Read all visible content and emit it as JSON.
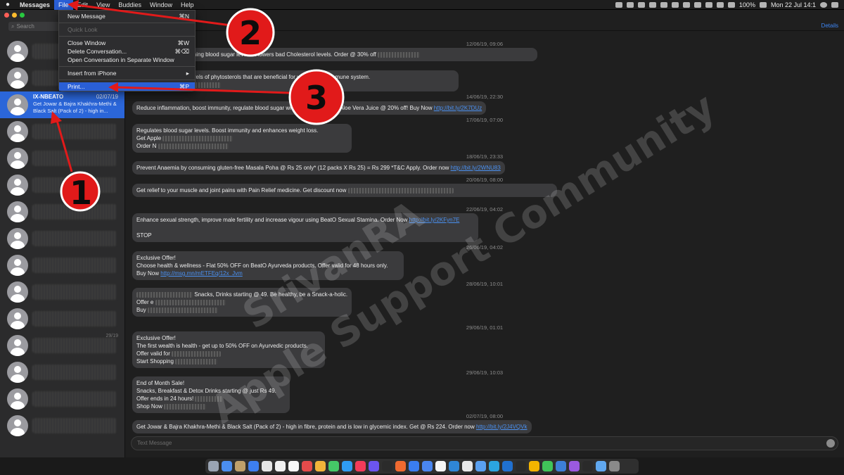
{
  "menubar": {
    "app": "Messages",
    "items": [
      "File",
      "Edit",
      "View",
      "Buddies",
      "Window",
      "Help"
    ],
    "battery": "100%",
    "datetime": "Mon 22 Jul  14:1"
  },
  "sidebar": {
    "search_placeholder": "Search",
    "selected_contact": {
      "name": "IX-NBEATO",
      "date": "02/07/19",
      "preview": "Get Jowar & Bajra Khakhra-Methi & Black Salt (Pack of 2) - high in..."
    },
    "side_date": "29/19"
  },
  "file_menu": {
    "items": [
      {
        "label": "New Message",
        "shortcut": "⌘N",
        "disabled": false,
        "highlighted": false
      },
      {
        "label": "Quick Look",
        "shortcut": "",
        "disabled": true,
        "highlighted": false
      },
      {
        "label": "Close Window",
        "shortcut": "⌘W",
        "disabled": false,
        "highlighted": false
      },
      {
        "label": "Delete Conversation...",
        "shortcut": "⌘⌫",
        "disabled": false,
        "highlighted": false
      },
      {
        "label": "Open Conversation in Separate Window",
        "shortcut": "",
        "disabled": false,
        "highlighted": false
      },
      {
        "label": "Insert from iPhone",
        "shortcut": "▸",
        "disabled": false,
        "highlighted": false
      },
      {
        "label": "Print...",
        "shortcut": "⌘P",
        "disabled": false,
        "highlighted": true
      }
    ]
  },
  "conversation": {
    "details_label": "Details",
    "composer_placeholder": "Text Message",
    "timestamps": [
      "12/06/19, 09:06",
      "14/06/19, 22:30",
      "17/06/19, 07:00",
      "18/06/19, 23:33",
      "20/06/19, 08:00",
      "22/06/19, 04:02",
      "26/06/19, 04:02",
      "28/06/19, 10:01",
      "29/06/19, 01:01",
      "29/06/19, 10:03",
      "02/07/19, 08:00"
    ],
    "messages": [
      {
        "text": "r daily, helps in maintaining blood sugar levels & lowers bad Cholesterol levels. Order @ 30% off"
      },
      {
        "text": "in one of the highest levels of phytosterols that are beneficial for your heart & immune system."
      },
      {
        "text": "Reduce inflammation, boost immunity, regulate blood sugar with Wheatgrass and Aloe Vera Juice @ 20% off! Buy Now",
        "link": "http://bit.ly/2K7DUz"
      },
      {
        "lines": [
          "Regulates blood sugar levels. Boost immunity and enhances weight loss.",
          "Get Apple",
          "Order N"
        ]
      },
      {
        "text": "Prevent Anaemia by consuming gluten-free Masala Poha @ Rs 25 only* (12 packs X Rs 25) = Rs 299 *T&C Apply. Order now",
        "link": "http://bit.ly/2WNU83"
      },
      {
        "text": "Get relief to your muscle and joint pains with Pain Relief medicine. Get discount now"
      },
      {
        "lines": [
          "Enhance sexual strength, improve male fertility and increase vigour using BeatO Sexual Stamina. Order Now",
          "",
          "STOP"
        ],
        "link": "http://bit.ly/2KFyn7E"
      },
      {
        "lines": [
          "Exclusive Offer!",
          "Choose health & wellness - Flat 50% OFF on BeatO Ayurveda products. Offer valid for 48 hours only.",
          "Buy Now"
        ],
        "link": "http://msg.mn/mETFEq/12x_Jvm"
      },
      {
        "lines": [
          "Snacks, Drinks starting @ 49. Be healthy, be a Snack-a-holic.",
          "Offer e",
          "Buy"
        ]
      },
      {
        "lines": [
          "Exclusive Offer!",
          "The first wealth is health - get up to 50% OFF on Ayurvedic products.",
          "Offer valid for",
          "Start Shopping"
        ]
      },
      {
        "lines": [
          "End of Month Sale!",
          "Snacks, Breakfast & Detox Drinks starting @ just Rs 49.",
          "Offer ends in 24 hours!",
          "Shop Now"
        ]
      },
      {
        "text": "Get Jowar & Bajra Khakhra-Methi & Black Salt (Pack of 2) - high in fibre, protein and is low in glycemic index. Get @ Rs 224. Order now",
        "link": "http://bit.ly/2J4VQVk"
      }
    ]
  },
  "annotations": {
    "badges": [
      "1",
      "2",
      "3"
    ],
    "watermark_line1": "SrivanRA",
    "watermark_line2": "Apple Support Community",
    "color": "#e11a1a"
  },
  "dock": {
    "icon_colors": [
      "#9aa4b3",
      "#4b8ef0",
      "#bfa06a",
      "#3d7ff0",
      "#e6e6e6",
      "#f1f1f1",
      "#f7f7f7",
      "#e54b4b",
      "#f2b43a",
      "#45c867",
      "#2f9cf3",
      "#f33b5a",
      "#6b55f0",
      "#2b2b2b",
      "#f06a30",
      "#3a7df0",
      "#4a86f0",
      "#f5f5f5",
      "#2f86d6",
      "#e8e8e8",
      "#5aa0f0",
      "#2ba5e0",
      "#2070d0",
      "#2a2a2a",
      "#f4b400",
      "#40c459",
      "#3d7fd6",
      "#9a5ae0",
      "#2a2a2a",
      "#60a8f0",
      "#8a8a8a"
    ]
  }
}
